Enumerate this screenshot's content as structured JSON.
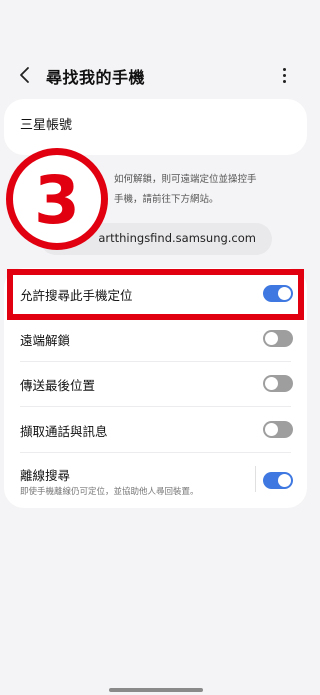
{
  "header": {
    "title": "尋找我的手機"
  },
  "account": {
    "label": "三星帳號"
  },
  "description": {
    "line1": "如何解鎖，則可遠端定位並操控手",
    "line2": "手機，請前往下方網站。"
  },
  "url": {
    "text": "artthingsfind.samsung.com"
  },
  "badge": {
    "number": "3"
  },
  "settings": [
    {
      "label": "允許搜尋此手機定位",
      "enabled": true
    },
    {
      "label": "遠端解鎖",
      "enabled": false
    },
    {
      "label": "傳送最後位置",
      "enabled": false
    },
    {
      "label": "擷取通話與訊息",
      "enabled": false
    },
    {
      "label": "離線搜尋",
      "subtitle": "即使手機離線仍可定位，並協助他人尋回裝置。",
      "enabled": true
    }
  ],
  "colors": {
    "accent": "#3e78e0",
    "highlight": "#e10010",
    "toggle_off": "#9e9e9e"
  }
}
